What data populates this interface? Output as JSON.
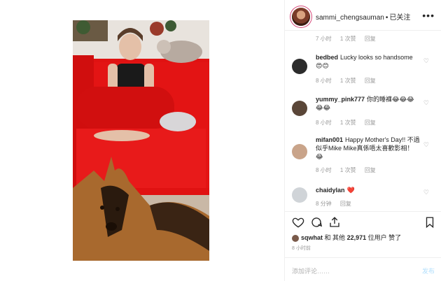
{
  "header": {
    "username": "sammi_chengsauman",
    "separator": "•",
    "follow": "已关注",
    "more": "•••"
  },
  "comments": [
    {
      "user": "",
      "text": "",
      "time": "7 小时",
      "likes": "1 次赞",
      "reply": "回复"
    },
    {
      "user": "bedbed",
      "text": "Lucky looks so handsome 😍😊",
      "time": "8 小时",
      "likes": "1 次赞",
      "reply": "回复"
    },
    {
      "user": "yummy_pink777",
      "text": "你的睡褲😂😂😂😂😂",
      "time": "8 小时",
      "likes": "1 次赞",
      "reply": "回复"
    },
    {
      "user": "mifan001",
      "text": "Happy Mother's Day!! 不過似乎Mike Mike真係唔太喜歡影相！😂",
      "time": "8 小时",
      "likes": "1 次赞",
      "reply": "回复"
    },
    {
      "user": "chaidylan",
      "text": "❤️",
      "time": "8 分钟",
      "likes": "",
      "reply": "回复"
    }
  ],
  "likes": {
    "prefix_user": "sqwhat",
    "and": "和 其他",
    "count": "22,971",
    "suffix": "位用户 赞了"
  },
  "post_time": "8 小时前",
  "add_comment": {
    "placeholder": "添加评论……",
    "post": "发布"
  },
  "icons": {
    "like": "heart-icon",
    "comment": "comment-icon",
    "share": "share-icon",
    "save": "bookmark-icon"
  }
}
